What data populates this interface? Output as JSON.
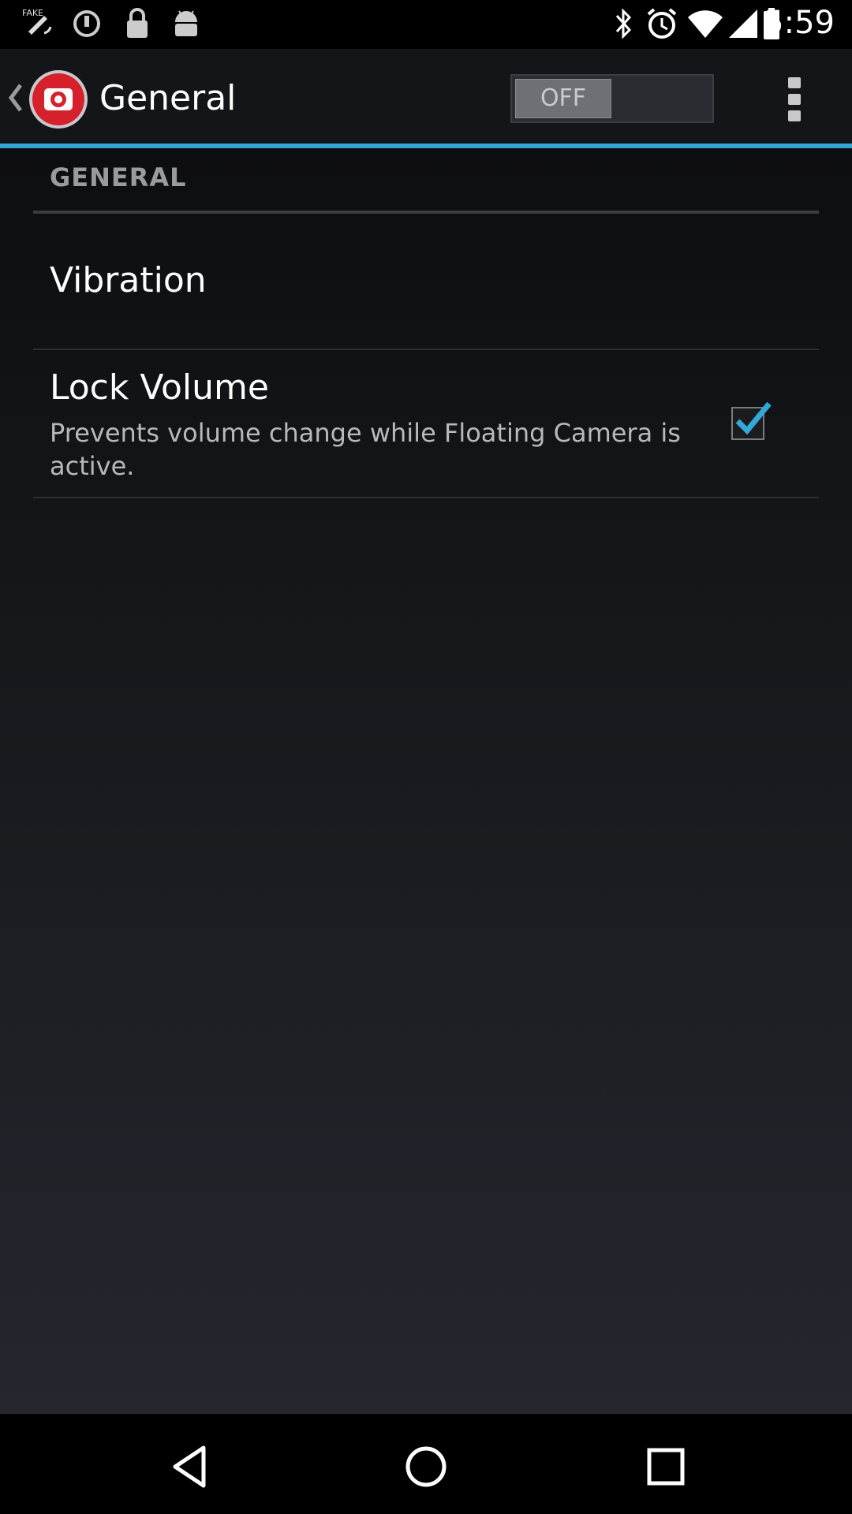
{
  "status_bar": {
    "time": "5:59",
    "left_icons": [
      "fake-gps-icon",
      "data-saver-icon",
      "lock-icon",
      "android-icon"
    ],
    "right_icons": [
      "bluetooth-icon",
      "alarm-icon",
      "wifi-icon",
      "signal-icon",
      "battery-icon"
    ]
  },
  "action_bar": {
    "title": "General",
    "toggle_label": "OFF",
    "toggle_state": "off",
    "accent_color": "#34a7d6"
  },
  "section": {
    "header": "GENERAL"
  },
  "items": [
    {
      "title": "Vibration"
    },
    {
      "title": "Lock Volume",
      "summary": "Prevents volume change while Floating Camera is active.",
      "checked": true
    }
  ],
  "nav_bar": {
    "buttons": [
      "back-icon",
      "home-icon",
      "recents-icon"
    ]
  }
}
